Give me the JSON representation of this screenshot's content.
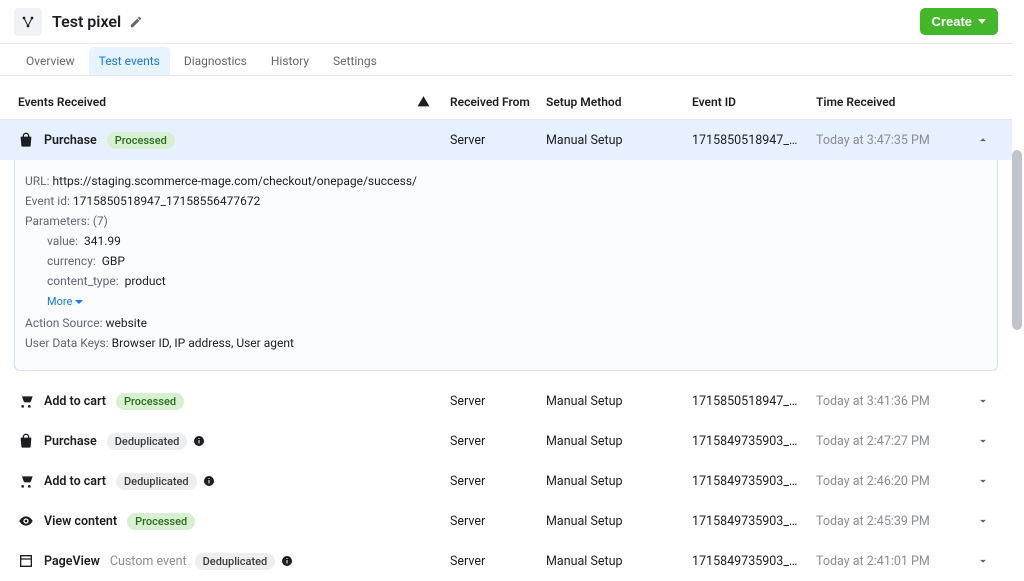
{
  "header": {
    "title": "Test pixel",
    "create_label": "Create"
  },
  "tabs": [
    {
      "label": "Overview",
      "active": false
    },
    {
      "label": "Test events",
      "active": true
    },
    {
      "label": "Diagnostics",
      "active": false
    },
    {
      "label": "History",
      "active": false
    },
    {
      "label": "Settings",
      "active": false
    }
  ],
  "columns": {
    "events": "Events Received",
    "from": "Received From",
    "setup": "Setup Method",
    "id": "Event ID",
    "time": "Time Received"
  },
  "expanded": {
    "name": "Purchase",
    "status": "Processed",
    "from": "Server",
    "setup": "Manual Setup",
    "id": "1715850518947_…",
    "time": "Today at 3:47:35 PM",
    "url_label": "URL:",
    "url": "https://staging.scommerce-mage.com/checkout/onepage/success/",
    "eventid_label": "Event id:",
    "eventid": "1715850518947_17158556477672",
    "params_label": "Parameters:",
    "params_count": "(7)",
    "params": [
      {
        "k": "value:",
        "v": "341.99"
      },
      {
        "k": "currency:",
        "v": "GBP"
      },
      {
        "k": "content_type:",
        "v": "product"
      }
    ],
    "more": "More",
    "action_src_label": "Action Source:",
    "action_src": "website",
    "udk_label": "User Data Keys:",
    "udk": "Browser ID, IP address, User agent"
  },
  "rows": [
    {
      "icon": "cart",
      "name": "Add to cart",
      "sub": "",
      "status": "Processed",
      "status_kind": "processed",
      "info": false,
      "from": "Server",
      "setup": "Manual Setup",
      "id": "1715850518947_…",
      "time": "Today at 3:41:36 PM"
    },
    {
      "icon": "bag",
      "name": "Purchase",
      "sub": "",
      "status": "Deduplicated",
      "status_kind": "dedup",
      "info": true,
      "from": "Server",
      "setup": "Manual Setup",
      "id": "1715849735903_…",
      "time": "Today at 2:47:27 PM"
    },
    {
      "icon": "cart",
      "name": "Add to cart",
      "sub": "",
      "status": "Deduplicated",
      "status_kind": "dedup",
      "info": true,
      "from": "Server",
      "setup": "Manual Setup",
      "id": "1715849735903_…",
      "time": "Today at 2:46:20 PM"
    },
    {
      "icon": "eye",
      "name": "View content",
      "sub": "",
      "status": "Processed",
      "status_kind": "processed",
      "info": false,
      "from": "Server",
      "setup": "Manual Setup",
      "id": "1715849735903_…",
      "time": "Today at 2:45:39 PM"
    },
    {
      "icon": "page",
      "name": "PageView",
      "sub": "Custom event",
      "status": "Deduplicated",
      "status_kind": "dedup",
      "info": true,
      "from": "Server",
      "setup": "Manual Setup",
      "id": "1715849735903_…",
      "time": "Today at 2:41:01 PM"
    }
  ]
}
